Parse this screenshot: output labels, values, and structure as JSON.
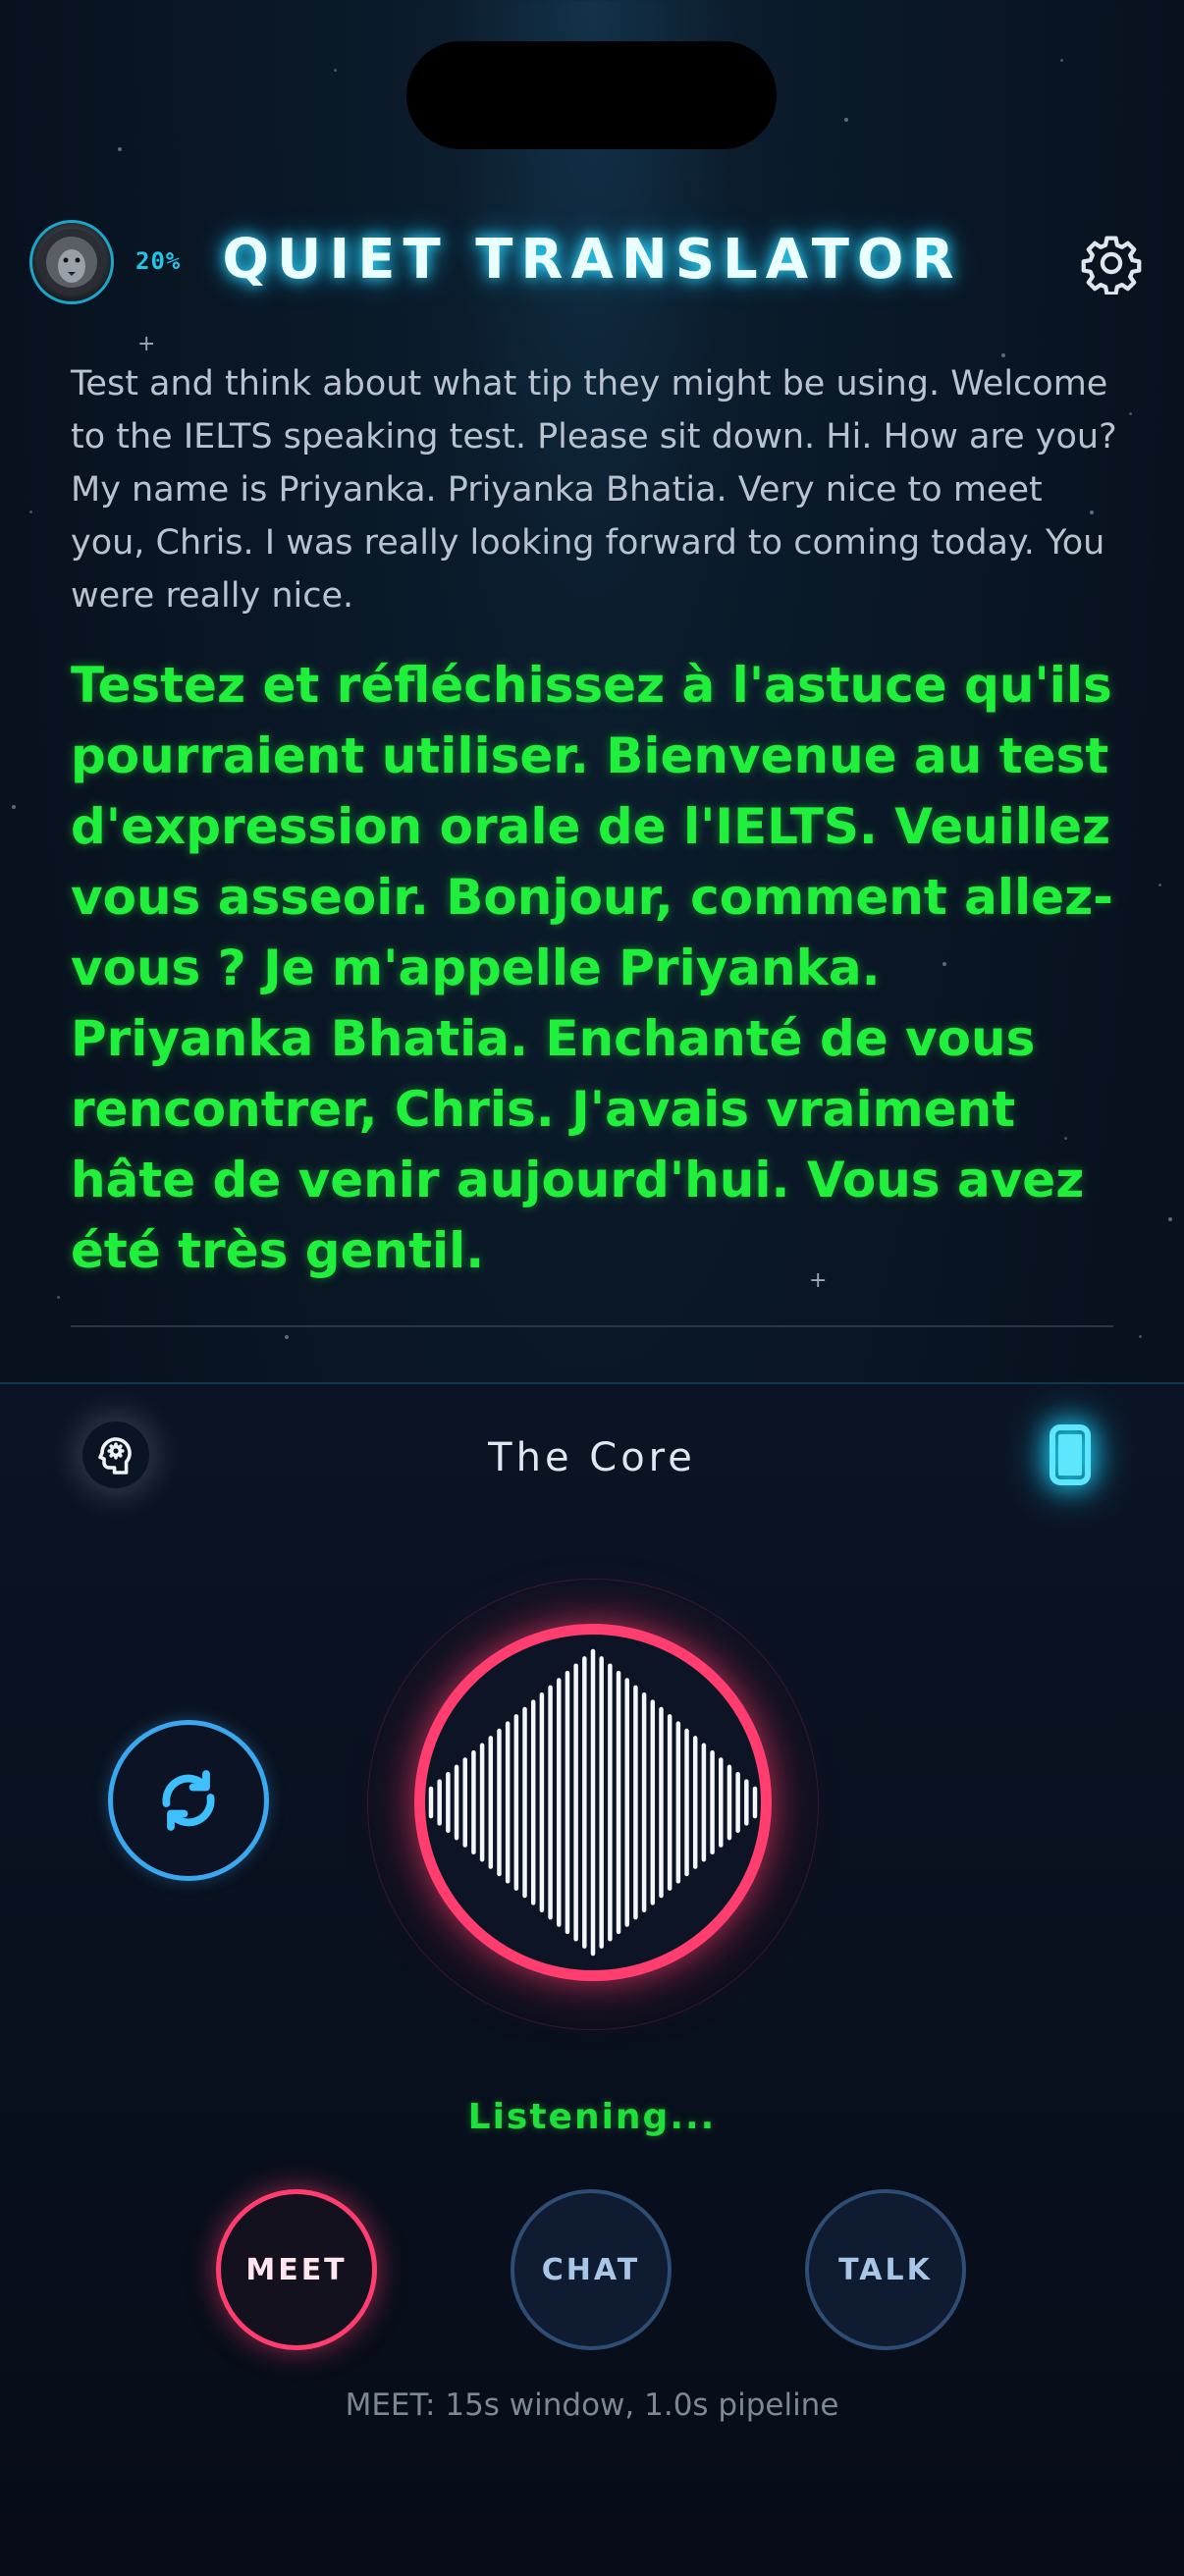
{
  "header": {
    "avatar_icon": "lion-avatar-icon",
    "battery_percent": "20%",
    "title": "QUIET TRANSLATOR",
    "settings_icon": "gear-icon"
  },
  "transcript": {
    "source": "Test and think about what tip they might be using. Welcome to the IELTS speaking test. Please sit down. Hi. How are you? My name is Priyanka. Priyanka Bhatia. Very nice to meet you, Chris. I was really looking forward to coming today. You were really nice.",
    "translation": "Testez et réfléchissez à l'astuce qu'ils pourraient utiliser. Bienvenue au test d'expression orale de l'IELTS. Veuillez vous asseoir. Bonjour, comment allez-vous ? Je m'appelle Priyanka. Priyanka Bhatia. Enchanté de vous rencontrer, Chris. J'avais vraiment hâte de venir aujourd'hui. Vous avez été très gentil."
  },
  "panel": {
    "brain_icon": "brain-head-icon",
    "core_label": "The Core",
    "device_icon": "phone-icon",
    "sync_icon": "sync-arrows-icon",
    "mic_icon": "waveform-icon",
    "status": "Listening...",
    "modes": [
      {
        "label": "MEET",
        "active": true
      },
      {
        "label": "CHAT",
        "active": false
      },
      {
        "label": "TALK",
        "active": false
      }
    ],
    "mode_info": "MEET: 15s window, 1.0s pipeline"
  },
  "colors": {
    "accent_cyan": "#22c5e8",
    "translation_green": "#20f03c",
    "mic_red": "#ff3d6e"
  }
}
